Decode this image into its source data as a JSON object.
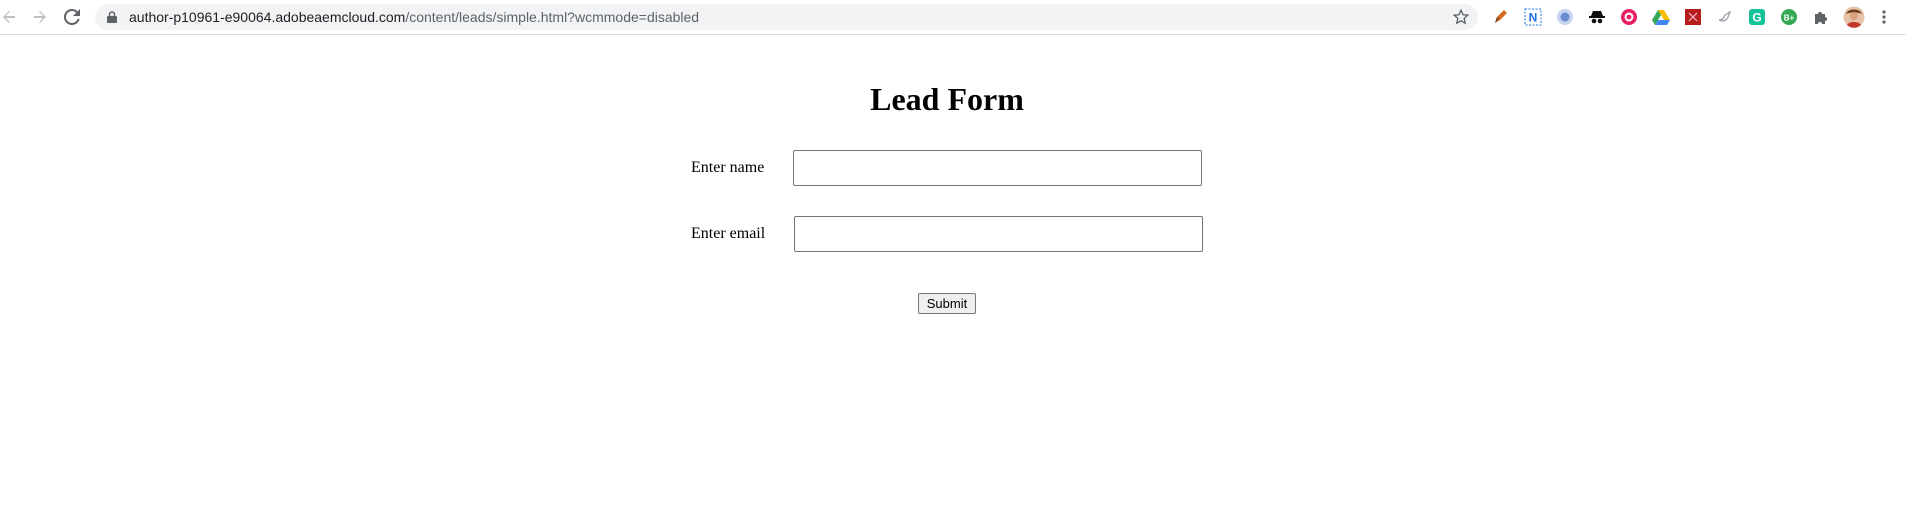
{
  "browser": {
    "url_host": "author-p10961-e90064.adobeaemcloud.com",
    "url_path": "/content/leads/simple.html?wcmmode=disabled",
    "icons": {
      "back": "back-arrow-icon",
      "forward": "forward-arrow-icon",
      "reload": "reload-icon",
      "lock": "lock-icon",
      "bookmark": "star-icon",
      "menu": "more-vert-icon"
    },
    "extensions": [
      {
        "name": "pen-extension-icon",
        "color": "#b5651d"
      },
      {
        "name": "n-extension-icon",
        "color": "#1a73e8",
        "glyph": "N"
      },
      {
        "name": "circle-extension-icon",
        "color": "#8ab4f8"
      },
      {
        "name": "spy-extension-icon",
        "color": "#000000"
      },
      {
        "name": "eye-extension-icon",
        "color": "#e91e63"
      },
      {
        "name": "drive-extension-icon",
        "color": "#fbbc04"
      },
      {
        "name": "red-square-extension-icon",
        "color": "#c62828"
      },
      {
        "name": "bird-extension-icon",
        "color": "#9e9e9e"
      },
      {
        "name": "grammarly-extension-icon",
        "color": "#15c39a",
        "glyph": "G"
      },
      {
        "name": "green-badge-extension-icon",
        "color": "#34a853",
        "glyph": "B+"
      },
      {
        "name": "puzzle-extensions-icon",
        "color": "#5f6368"
      },
      {
        "name": "profile-avatar-icon",
        "color": "#a0522d"
      }
    ]
  },
  "form": {
    "title": "Lead Form",
    "name_label": "Enter name",
    "name_value": "",
    "email_label": "Enter email",
    "email_value": "",
    "submit_label": "Submit"
  }
}
